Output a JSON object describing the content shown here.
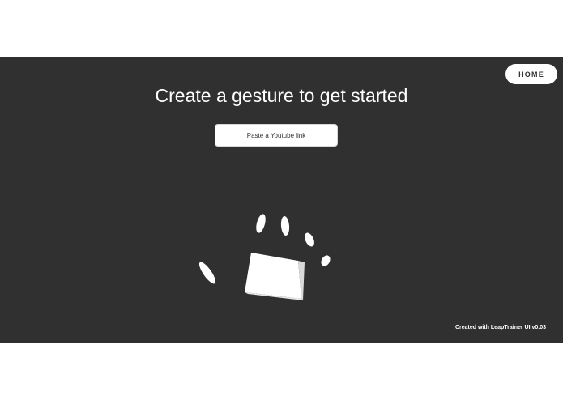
{
  "header": {
    "home_label": "HOME"
  },
  "main": {
    "title": "Create a gesture to get started",
    "link_input_placeholder": "Paste a Youtube link",
    "hand_visual": "hand-gesture-illustration"
  },
  "footer": {
    "credit": "Created with LeapTrainer UI v0.03"
  },
  "colors": {
    "background": "#303030",
    "foreground": "#ffffff"
  }
}
